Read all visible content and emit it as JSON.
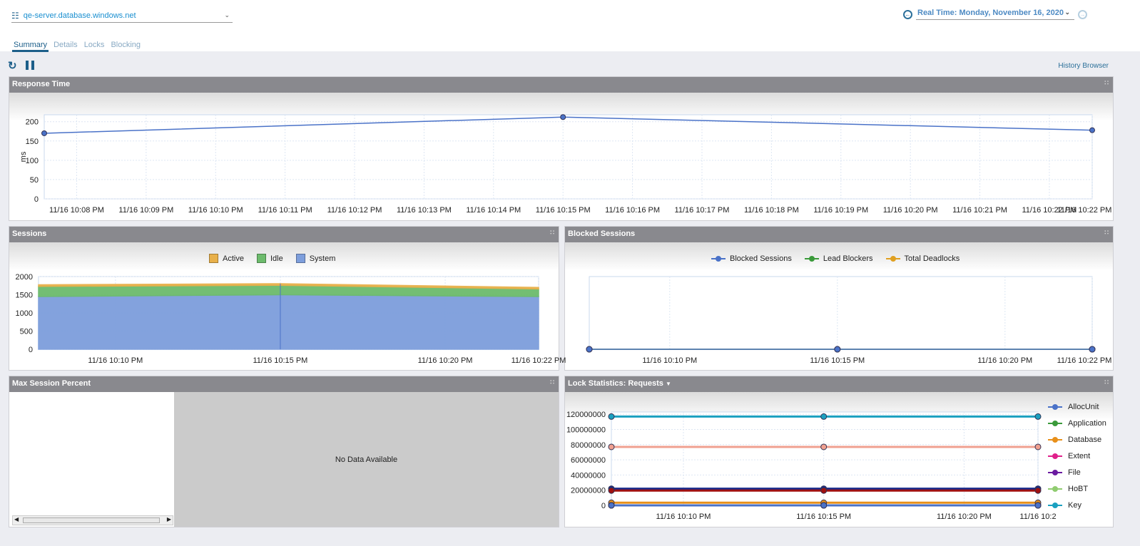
{
  "header": {
    "server": "qe-server.database.windows.net",
    "realtime": "Real Time: Monday, November 16, 2020",
    "history_browser": "History Browser"
  },
  "tabs": [
    {
      "label": "Summary",
      "active": true
    },
    {
      "label": "Details"
    },
    {
      "label": "Locks"
    },
    {
      "label": "Blocking"
    }
  ],
  "toolbar": {
    "icons": [
      "refresh-icon",
      "pause-icon"
    ]
  },
  "panels": {
    "response": "Response Time",
    "sessions": "Sessions",
    "blocked": "Blocked Sessions",
    "maxsession": "Max Session Percent",
    "lock": "Lock Statistics: Requests",
    "no_data": "No Data Available"
  },
  "chart_data": [
    {
      "id": "response",
      "type": "line",
      "ylabel": "ms",
      "xlim": [
        "22:07:32",
        "22:22:37"
      ],
      "ylim": [
        0,
        218
      ],
      "yticks": [
        0,
        50,
        100,
        150,
        200
      ],
      "xticks": [
        "11/16 10:08 PM",
        "11/16 10:09 PM",
        "11/16 10:10 PM",
        "11/16 10:11 PM",
        "11/16 10:12 PM",
        "11/16 10:13 PM",
        "11/16 10:14 PM",
        "11/16 10:15 PM",
        "11/16 10:16 PM",
        "11/16 10:17 PM",
        "11/16 10:18 PM",
        "11/16 10:19 PM",
        "11/16 10:20 PM",
        "11/16 10:21 PM",
        "11/16 10:22 PM",
        "11/16 10:22 PM"
      ],
      "xtick_times": [
        "22:08",
        "22:09",
        "22:10",
        "22:11",
        "22:12",
        "22:13",
        "22:14",
        "22:15",
        "22:16",
        "22:17",
        "22:18",
        "22:19",
        "22:20",
        "22:21",
        "22:22",
        "22:22:37"
      ],
      "grid": true,
      "series": [
        {
          "color": "#4a72c8",
          "x": [
            "22:07:32",
            "22:15:00",
            "22:22:37"
          ],
          "y": [
            170,
            212,
            178
          ]
        }
      ]
    },
    {
      "id": "sessions",
      "type": "area",
      "stacked": true,
      "legend": "top",
      "xlim": [
        "22:07:40",
        "22:22:50"
      ],
      "ylim": [
        0,
        2000
      ],
      "yticks": [
        0,
        500,
        1000,
        1500,
        2000
      ],
      "xticks": [
        "11/16 10:10 PM",
        "11/16 10:15 PM",
        "11/16 10:20 PM",
        "11/16 10:22 PM"
      ],
      "xtick_times": [
        "22:10",
        "22:15",
        "22:20",
        "22:22:50"
      ],
      "grid": true,
      "series": [
        {
          "name": "System",
          "color": "#7d9edc",
          "x": [
            "22:07:40",
            "22:15:00",
            "22:22:50"
          ],
          "y": [
            1450,
            1500,
            1450
          ]
        },
        {
          "name": "Idle",
          "color": "#6cbb6c",
          "x": [
            "22:07:40",
            "22:15:00",
            "22:22:50"
          ],
          "y": [
            280,
            260,
            210
          ]
        },
        {
          "name": "Active",
          "color": "#e8b04a",
          "x": [
            "22:07:40",
            "22:15:00",
            "22:22:50"
          ],
          "y": [
            45,
            45,
            40
          ]
        }
      ]
    },
    {
      "id": "blocked",
      "type": "line",
      "legend": "top",
      "xlim": [
        "22:07:36",
        "22:22:36"
      ],
      "ylim": [
        0,
        1
      ],
      "yticks": [],
      "xticks": [
        "11/16 10:10 PM",
        "11/16 10:15 PM",
        "11/16 10:20 PM",
        "11/16 10:22 PM"
      ],
      "xtick_times": [
        "22:10",
        "22:15",
        "22:20",
        "22:22:36"
      ],
      "grid": true,
      "series": [
        {
          "name": "Total Deadlocks",
          "color": "#e0a020",
          "x": [
            "22:07:36",
            "22:15:00",
            "22:22:36"
          ],
          "y": [
            0,
            0,
            0
          ]
        },
        {
          "name": "Lead Blockers",
          "color": "#3a9a3a",
          "x": [
            "22:07:36",
            "22:15:00",
            "22:22:36"
          ],
          "y": [
            0,
            0,
            0
          ]
        },
        {
          "name": "Blocked Sessions",
          "color": "#4a72c8",
          "x": [
            "22:07:36",
            "22:15:00",
            "22:22:36"
          ],
          "y": [
            0,
            0,
            0
          ]
        }
      ]
    },
    {
      "id": "lock",
      "type": "line",
      "legend": "right",
      "xlim": [
        "22:07:26",
        "22:22:38"
      ],
      "ylim": [
        0,
        123000000
      ],
      "yticks": [
        0,
        20000000,
        40000000,
        60000000,
        80000000,
        100000000,
        120000000
      ],
      "xticks": [
        "11/16 10:10 PM",
        "11/16 10:15 PM",
        "11/16 10:20 PM",
        "11/16 10:2"
      ],
      "xtick_times": [
        "22:10",
        "22:15",
        "22:20",
        "22:22:38"
      ],
      "grid": true,
      "series": [
        {
          "name": "Key",
          "color": "#1aa0c0",
          "x": [
            "22:07:26",
            "22:15:00",
            "22:22:38"
          ],
          "y": [
            117000000,
            117000000,
            117000000
          ]
        },
        {
          "color": "#f0a090",
          "x": [
            "22:07:26",
            "22:15:00",
            "22:22:38"
          ],
          "y": [
            77000000,
            77000000,
            77000000
          ]
        },
        {
          "color": "#1a2a8a",
          "x": [
            "22:07:26",
            "22:15:00",
            "22:22:38"
          ],
          "y": [
            22000000,
            22000000,
            22000000
          ]
        },
        {
          "color": "#a01010",
          "x": [
            "22:07:26",
            "22:15:00",
            "22:22:38"
          ],
          "y": [
            19500000,
            19500000,
            19500000
          ]
        },
        {
          "name": "Database",
          "color": "#e8901a",
          "x": [
            "22:07:26",
            "22:15:00",
            "22:22:38"
          ],
          "y": [
            3500000,
            3500000,
            3500000
          ]
        },
        {
          "name": "HoBT",
          "color": "#90cc70",
          "x": [
            "22:07:26",
            "22:15:00",
            "22:22:38"
          ],
          "y": [
            0,
            0,
            0
          ]
        },
        {
          "name": "File",
          "color": "#6a1aa0",
          "x": [
            "22:07:26",
            "22:15:00",
            "22:22:38"
          ],
          "y": [
            0,
            0,
            0
          ]
        },
        {
          "name": "Extent",
          "color": "#e0208a",
          "x": [
            "22:07:26",
            "22:15:00",
            "22:22:38"
          ],
          "y": [
            0,
            0,
            0
          ]
        },
        {
          "name": "Application",
          "color": "#3a9a3a",
          "x": [
            "22:07:26",
            "22:15:00",
            "22:22:38"
          ],
          "y": [
            0,
            0,
            0
          ]
        },
        {
          "name": "AllocUnit",
          "color": "#4a72c8",
          "x": [
            "22:07:26",
            "22:15:00",
            "22:22:38"
          ],
          "y": [
            0,
            0,
            0
          ]
        }
      ]
    }
  ],
  "legends": {
    "sessions": [
      {
        "label": "Active",
        "color": "#e8b04a"
      },
      {
        "label": "Idle",
        "color": "#6cbb6c"
      },
      {
        "label": "System",
        "color": "#7d9edc"
      }
    ],
    "blocked": [
      {
        "label": "Blocked Sessions",
        "color": "#4a72c8"
      },
      {
        "label": "Lead Blockers",
        "color": "#3a9a3a"
      },
      {
        "label": "Total Deadlocks",
        "color": "#e0a020"
      }
    ],
    "lock": [
      {
        "label": "AllocUnit",
        "color": "#4a72c8"
      },
      {
        "label": "Application",
        "color": "#3a9a3a"
      },
      {
        "label": "Database",
        "color": "#e8901a"
      },
      {
        "label": "Extent",
        "color": "#e0208a"
      },
      {
        "label": "File",
        "color": "#6a1aa0"
      },
      {
        "label": "HoBT",
        "color": "#90cc70"
      },
      {
        "label": "Key",
        "color": "#1aa0c0"
      }
    ]
  }
}
